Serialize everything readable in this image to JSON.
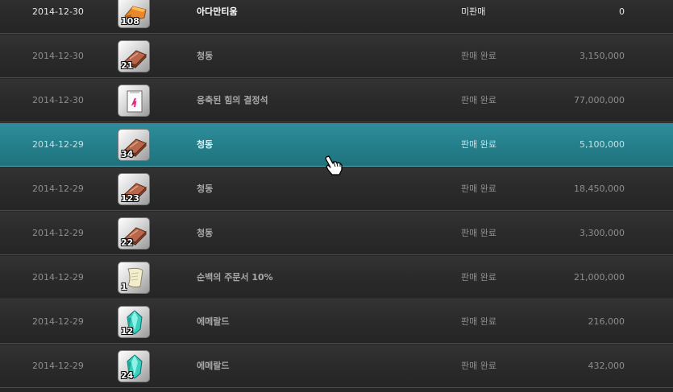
{
  "rows": [
    {
      "date": "2014-12-30",
      "item": "아다만티움",
      "status": "미판매",
      "price": "0",
      "qty": "108",
      "icon": "adamantium-ore-icon",
      "state": "unsold"
    },
    {
      "date": "2014-12-30",
      "item": "청동",
      "status": "판매 완료",
      "price": "3,150,000",
      "qty": "21",
      "icon": "bronze-plate-icon",
      "state": "sold"
    },
    {
      "date": "2014-12-30",
      "item": "응축된 힘의 결정석",
      "status": "판매 완료",
      "price": "77,000,000",
      "qty": "",
      "icon": "crystal-scroll-icon",
      "state": "sold"
    },
    {
      "date": "2014-12-29",
      "item": "청동",
      "status": "판매 완료",
      "price": "5,100,000",
      "qty": "34",
      "icon": "bronze-plate-icon",
      "state": "selected"
    },
    {
      "date": "2014-12-29",
      "item": "청동",
      "status": "판매 완료",
      "price": "18,450,000",
      "qty": "123",
      "icon": "bronze-plate-icon",
      "state": "sold"
    },
    {
      "date": "2014-12-29",
      "item": "청동",
      "status": "판매 완료",
      "price": "3,300,000",
      "qty": "22",
      "icon": "bronze-plate-icon",
      "state": "sold"
    },
    {
      "date": "2014-12-29",
      "item": "순백의 주문서 10%",
      "status": "판매 완료",
      "price": "21,000,000",
      "qty": "1",
      "icon": "scroll-icon",
      "state": "sold"
    },
    {
      "date": "2014-12-29",
      "item": "에메랄드",
      "status": "판매 완료",
      "price": "216,000",
      "qty": "12",
      "icon": "emerald-icon",
      "state": "sold"
    },
    {
      "date": "2014-12-29",
      "item": "에메랄드",
      "status": "판매 완료",
      "price": "432,000",
      "qty": "24",
      "icon": "emerald-icon",
      "state": "sold"
    }
  ],
  "cursor": {
    "icon": "hand-cursor-icon"
  }
}
